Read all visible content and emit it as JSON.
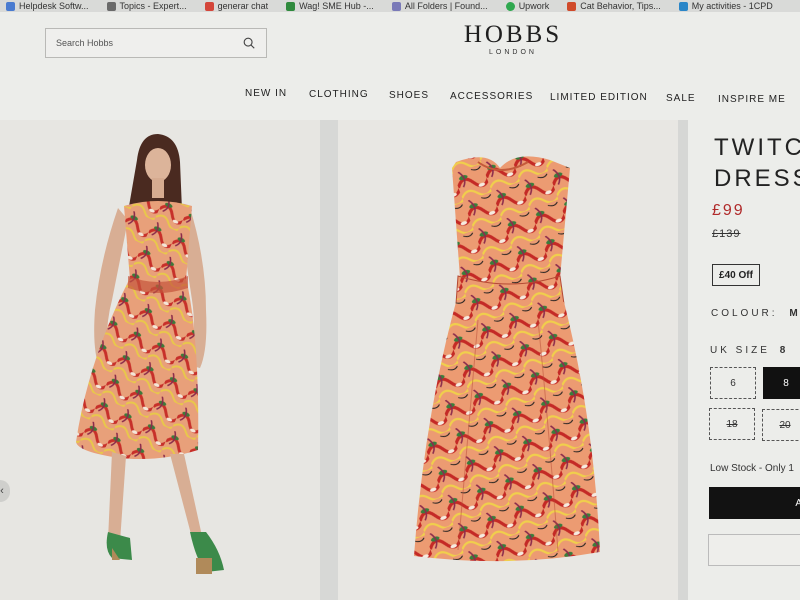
{
  "bookmarks": [
    {
      "label": "Helpdesk Softw...",
      "color": "#4a7bd0"
    },
    {
      "label": "Topics - Expert...",
      "color": "#6a6a6a"
    },
    {
      "label": "generar chat",
      "color": "#d4463a"
    },
    {
      "label": "Wag! SME Hub -...",
      "color": "#2f8a3d"
    },
    {
      "label": "All Folders | Found...",
      "color": "#7a7ab8"
    },
    {
      "label": "Upwork",
      "color": "#2fa84f"
    },
    {
      "label": "Cat Behavior, Tips...",
      "color": "#d04a2a"
    },
    {
      "label": "My activities - 1CPD",
      "color": "#2a86c8"
    }
  ],
  "search": {
    "placeholder": "Search Hobbs",
    "icon": "search-icon"
  },
  "brand": {
    "name": "HOBBS",
    "tagline": "LONDON"
  },
  "nav": [
    "NEW IN",
    "CLOTHING",
    "SHOES",
    "ACCESSORIES",
    "LIMITED EDITION",
    "SALE",
    "INSPIRE ME"
  ],
  "product": {
    "title_line1": "TWITC",
    "title_line2": "DRESS",
    "price": "£99",
    "old_price": "£139",
    "discount": "£40 Off",
    "colour_label": "COLOUR:",
    "colour_value": "M",
    "size_label": "UK SIZE",
    "size_value": "8",
    "sizes": [
      {
        "label": "6",
        "state": "available"
      },
      {
        "label": "8",
        "state": "selected"
      },
      {
        "label": "18",
        "state": "unavailable"
      },
      {
        "label": "20",
        "state": "unavailable"
      }
    ],
    "stock": "Low Stock - Only 1",
    "add_label": "A",
    "price_color": "#b02a2a"
  },
  "gallery": {
    "prev_arrow": "‹"
  }
}
